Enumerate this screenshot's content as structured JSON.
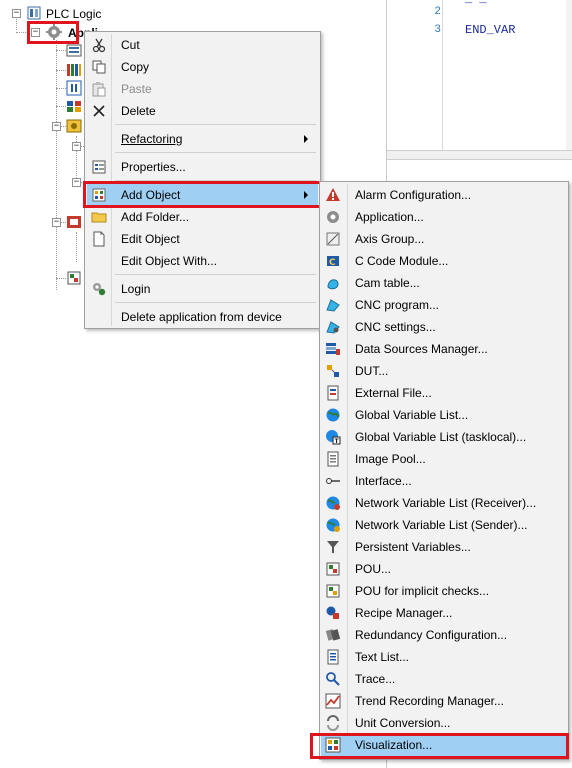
{
  "tree": {
    "root_label": "PLC Logic",
    "app_label_partial": "Appli",
    "root_expander": "−",
    "app_expander": "−",
    "sub_expanders": [
      "−",
      "−",
      "−",
      "−"
    ]
  },
  "editor": {
    "line_numbers": [
      "2",
      "3"
    ],
    "code_line": "END_VAR",
    "top_fragment": "_   _"
  },
  "context_menu": {
    "items": [
      {
        "label": "Cut",
        "icon": "scissors-icon",
        "disabled": false
      },
      {
        "label": "Copy",
        "icon": "copy-icon",
        "disabled": false
      },
      {
        "label": "Paste",
        "icon": "paste-icon",
        "disabled": true
      },
      {
        "label": "Delete",
        "icon": "delete-x-icon",
        "disabled": false
      },
      {
        "label": "Refactoring",
        "icon": "",
        "submenu": true,
        "mnemonic_index": 0
      },
      {
        "label": "Properties...",
        "icon": "properties-icon",
        "disabled": false
      },
      {
        "label": "Add Object",
        "icon": "add-object-icon",
        "submenu": true,
        "highlighted": true
      },
      {
        "label": "Add Folder...",
        "icon": "folder-icon",
        "disabled": false
      },
      {
        "label": "Edit Object",
        "icon": "edit-object-icon",
        "disabled": false
      },
      {
        "label": "Edit Object With...",
        "icon": "",
        "disabled": false
      },
      {
        "label": "Login",
        "icon": "login-icon",
        "disabled": false
      },
      {
        "label": "Delete application from device",
        "icon": "",
        "disabled": false
      }
    ]
  },
  "add_object_menu": {
    "items": [
      {
        "label": "Alarm Configuration...",
        "icon": "alarm-icon"
      },
      {
        "label": "Application...",
        "icon": "gear-icon"
      },
      {
        "label": "Axis Group...",
        "icon": "axis-group-icon"
      },
      {
        "label": "C Code Module...",
        "icon": "c-code-icon"
      },
      {
        "label": "Cam table...",
        "icon": "cam-icon"
      },
      {
        "label": "CNC program...",
        "icon": "cnc-program-icon"
      },
      {
        "label": "CNC settings...",
        "icon": "cnc-settings-icon"
      },
      {
        "label": "Data Sources Manager...",
        "icon": "data-sources-icon"
      },
      {
        "label": "DUT...",
        "icon": "dut-icon"
      },
      {
        "label": "External File...",
        "icon": "external-file-icon"
      },
      {
        "label": "Global Variable List...",
        "icon": "globe-icon"
      },
      {
        "label": "Global Variable List (tasklocal)...",
        "icon": "globe-tasklocal-icon"
      },
      {
        "label": "Image Pool...",
        "icon": "image-pool-icon"
      },
      {
        "label": "Interface...",
        "icon": "interface-icon"
      },
      {
        "label": "Network Variable List (Receiver)...",
        "icon": "network-receiver-icon"
      },
      {
        "label": "Network Variable List (Sender)...",
        "icon": "network-sender-icon"
      },
      {
        "label": "Persistent Variables...",
        "icon": "persistent-icon"
      },
      {
        "label": "POU...",
        "icon": "pou-icon"
      },
      {
        "label": "POU for implicit checks...",
        "icon": "pou-checks-icon"
      },
      {
        "label": "Recipe Manager...",
        "icon": "recipe-icon"
      },
      {
        "label": "Redundancy Configuration...",
        "icon": "redundancy-icon"
      },
      {
        "label": "Text List...",
        "icon": "text-list-icon"
      },
      {
        "label": "Trace...",
        "icon": "trace-icon"
      },
      {
        "label": "Trend Recording Manager...",
        "icon": "trend-icon"
      },
      {
        "label": "Unit Conversion...",
        "icon": "unit-conversion-icon"
      },
      {
        "label": "Visualization...",
        "icon": "visualization-icon",
        "highlighted": true
      }
    ]
  },
  "colors": {
    "highlight": "#9fd0f4",
    "annotation_red": "#e0141e",
    "menu_bg": "#f2f2f2",
    "code_blue": "#1a2a9c"
  }
}
